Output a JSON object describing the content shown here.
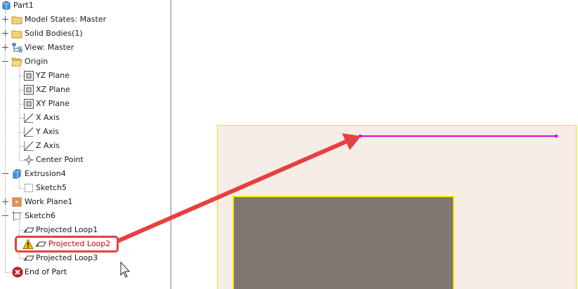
{
  "tree": {
    "items": [
      {
        "label": "Part1",
        "icon": "part-icon"
      },
      {
        "label": "Model States: Master",
        "icon": "folder-icon"
      },
      {
        "label": "Solid Bodies(1)",
        "icon": "folder-icon"
      },
      {
        "label": "View: Master",
        "icon": "view-icon"
      },
      {
        "label": "Origin",
        "icon": "folder-open-icon"
      },
      {
        "label": "YZ Plane",
        "icon": "plane-icon"
      },
      {
        "label": "XZ Plane",
        "icon": "plane-icon"
      },
      {
        "label": "XY Plane",
        "icon": "plane-icon"
      },
      {
        "label": "X Axis",
        "icon": "axis-icon"
      },
      {
        "label": "Y Axis",
        "icon": "axis-icon"
      },
      {
        "label": "Z Axis",
        "icon": "axis-icon"
      },
      {
        "label": "Center Point",
        "icon": "center-point-icon"
      },
      {
        "label": "Extrusion4",
        "icon": "extrusion-icon"
      },
      {
        "label": "Sketch5",
        "icon": "sketch-icon"
      },
      {
        "label": "Work Plane1",
        "icon": "work-plane-icon"
      },
      {
        "label": "Sketch6",
        "icon": "sketch-icon"
      },
      {
        "label": "Projected Loop1",
        "icon": "projected-loop-icon"
      },
      {
        "label": "Projected Loop2",
        "icon": "projected-loop-icon",
        "status": "warning"
      },
      {
        "label": "Projected Loop3",
        "icon": "projected-loop-icon"
      },
      {
        "label": "End of Part",
        "icon": "error-icon"
      }
    ]
  },
  "colors": {
    "callout": "#e64040",
    "projected_line": "#e000e0",
    "sheet_fill": "#f6ede6",
    "sheet_outline": "#f0e000",
    "solid_fill": "#807772",
    "warning": "#f5c400",
    "error": "#d42020"
  }
}
